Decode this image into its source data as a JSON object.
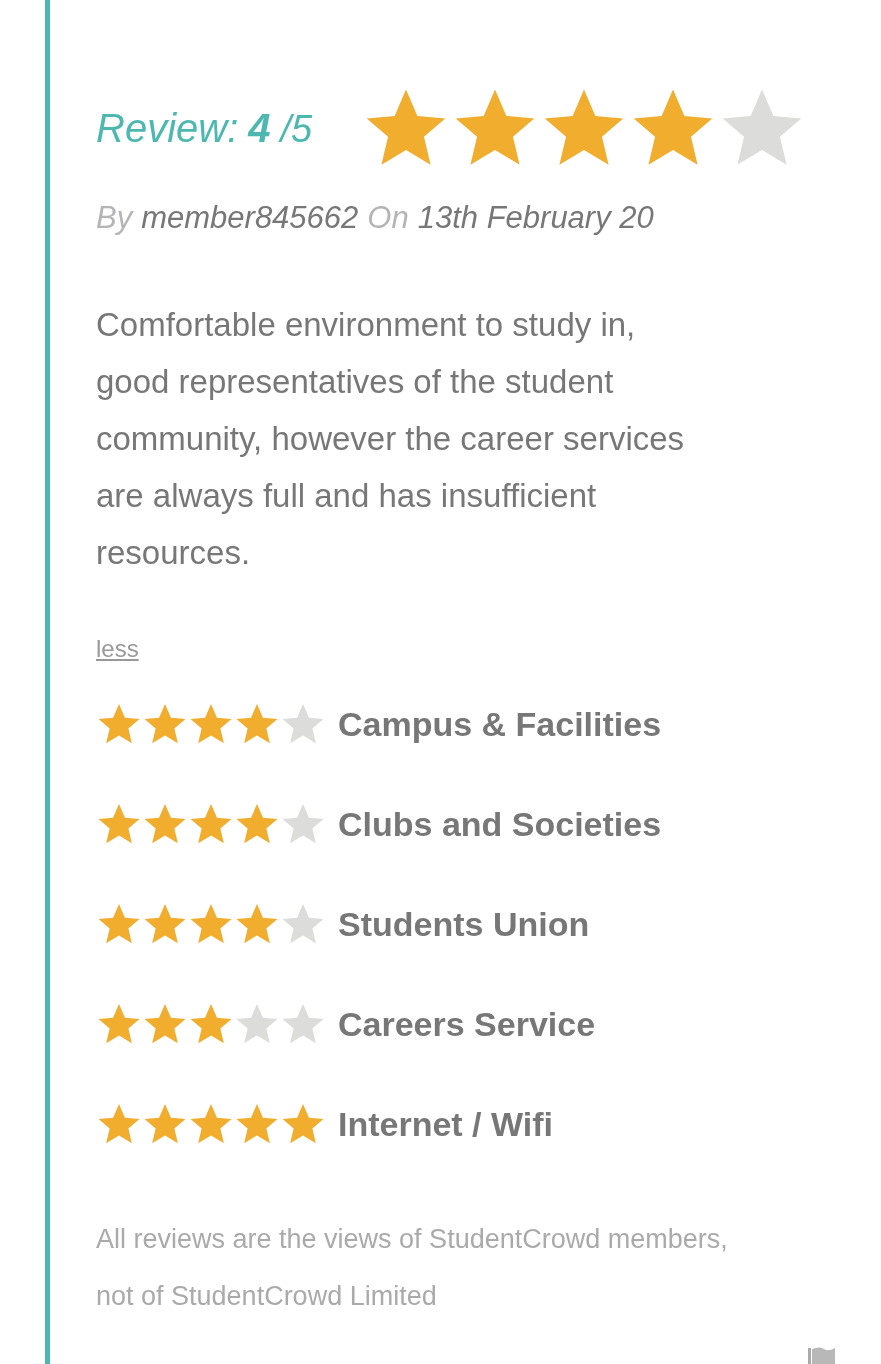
{
  "review": {
    "label": "Review:",
    "score": "4",
    "out_of": "/5",
    "stars": 4
  },
  "meta": {
    "by": "By",
    "author": "member845662",
    "on": "On",
    "date": "13th February 20"
  },
  "body": "Comfortable environment to study in, good representatives of the student community, however the career services are always full and has insufficient resources.",
  "less_link": "less",
  "ratings": [
    {
      "name": "Campus & Facilities",
      "stars": 4
    },
    {
      "name": "Clubs and Societies",
      "stars": 4
    },
    {
      "name": "Students Union",
      "stars": 4
    },
    {
      "name": "Careers Service",
      "stars": 3
    },
    {
      "name": "Internet / Wifi",
      "stars": 5
    }
  ],
  "disclaimer": "All reviews are the views of StudentCrowd members, not of StudentCrowd Limited"
}
